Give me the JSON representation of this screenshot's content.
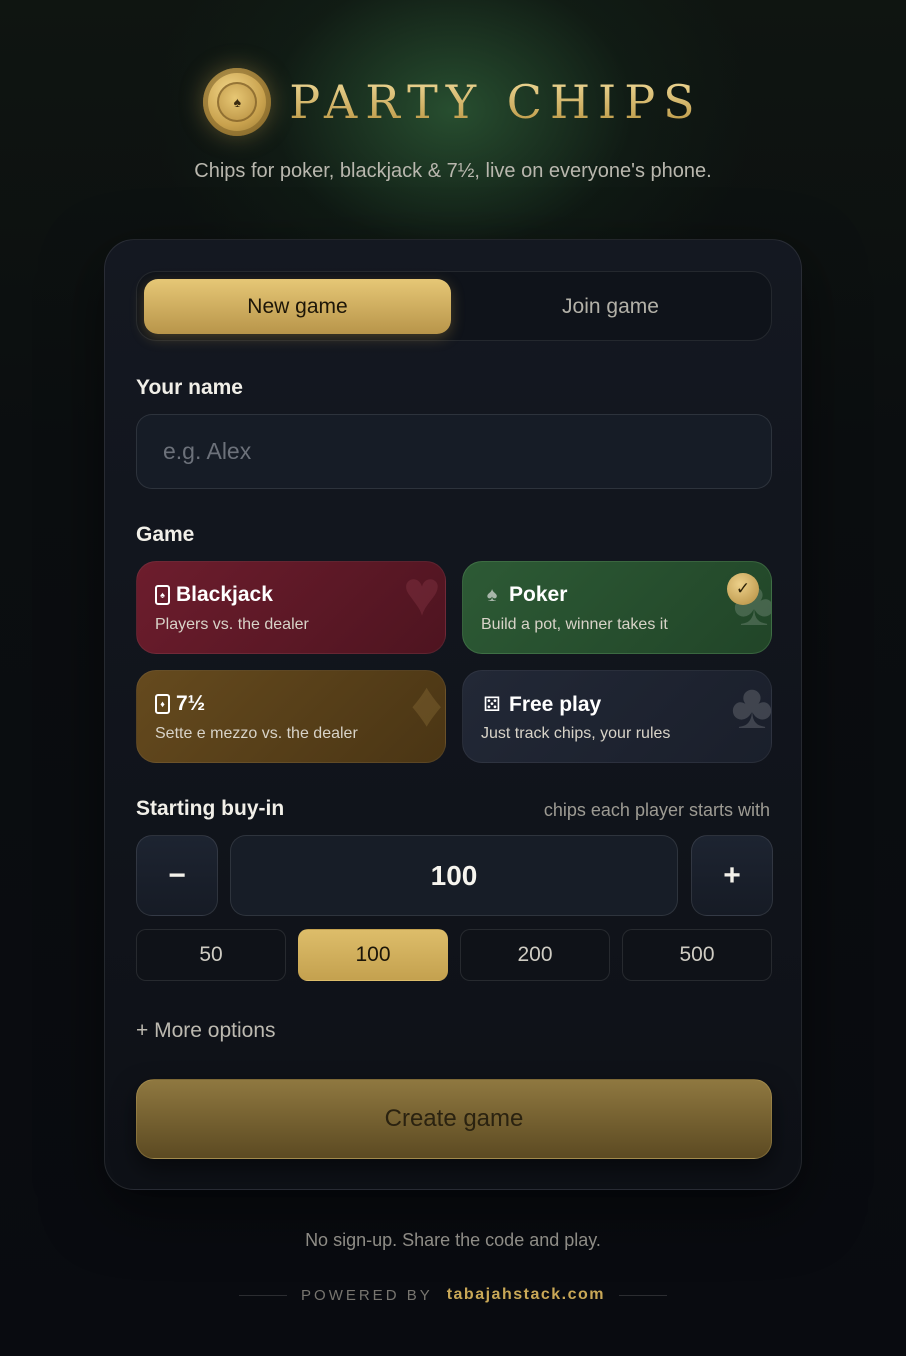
{
  "brand": {
    "title": "PARTY CHIPS",
    "tagline": "Chips for poker, blackjack & 7½, live on everyone's phone."
  },
  "tabs": [
    {
      "label": "New game",
      "active": true
    },
    {
      "label": "Join game",
      "active": false
    }
  ],
  "name_field": {
    "label": "Your name",
    "placeholder": "e.g. Alex",
    "value": ""
  },
  "game": {
    "label": "Game",
    "options": [
      {
        "title": "Blackjack",
        "description": "Players vs. the dealer",
        "icon": "playing-card-icon",
        "selected": false,
        "color": "#6d1d2d"
      },
      {
        "title": "Poker",
        "description": "Build a pot, winner takes it",
        "icon": "spade-icon",
        "selected": true,
        "color": "#2d5a35"
      },
      {
        "title": "7½",
        "description": "Sette e mezzo vs. the dealer",
        "icon": "playing-card-icon",
        "selected": false,
        "color": "#654a1e"
      },
      {
        "title": "Free play",
        "description": "Just track chips, your rules",
        "icon": "dice-icon",
        "selected": false,
        "color": "#222836"
      }
    ]
  },
  "buyin": {
    "label": "Starting buy-in",
    "hint": "chips each player starts with",
    "decrement": "−",
    "increment": "+",
    "value": "100",
    "presets": [
      "50",
      "100",
      "200",
      "500"
    ],
    "selected_preset": "100"
  },
  "more_options": "+ More options",
  "create_button": "Create game",
  "footer": {
    "note": "No sign-up. Share the code and play.",
    "powered_by": "POWERED BY",
    "link": "tabajahstack.com"
  },
  "colors": {
    "gold": "#d6b565",
    "background": "#0b0e12",
    "card": "#12161e"
  }
}
